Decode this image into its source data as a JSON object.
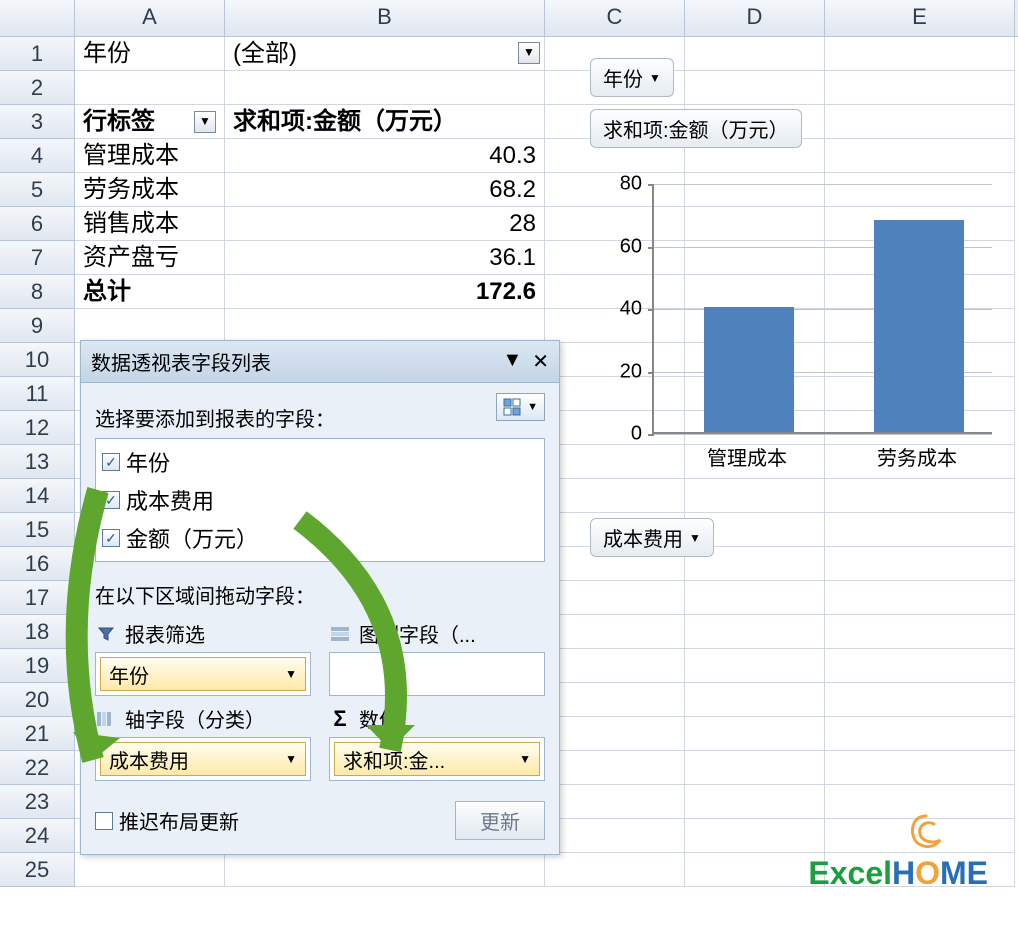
{
  "columns": [
    "A",
    "B",
    "C",
    "D",
    "E"
  ],
  "rows": [
    "1",
    "2",
    "3",
    "4",
    "5",
    "6",
    "7",
    "8",
    "9",
    "10",
    "11",
    "12",
    "13",
    "14",
    "15",
    "16",
    "17",
    "18",
    "19",
    "20",
    "21",
    "22",
    "23",
    "24",
    "25"
  ],
  "pivot": {
    "filter_field": "年份",
    "filter_value": "(全部)",
    "row_label_header": "行标签",
    "value_header": "求和项:金额（万元）",
    "rows": [
      {
        "label": "管理成本",
        "value": "40.3"
      },
      {
        "label": "劳务成本",
        "value": "68.2"
      },
      {
        "label": "销售成本",
        "value": "28"
      },
      {
        "label": "资产盘亏",
        "value": "36.1"
      }
    ],
    "total_label": "总计",
    "total_value": "172.6"
  },
  "panel": {
    "title": "数据透视表字段列表",
    "select_label": "选择要添加到报表的字段：",
    "fields": [
      {
        "name": "年份",
        "checked": true
      },
      {
        "name": "成本费用",
        "checked": true
      },
      {
        "name": "金额（万元）",
        "checked": true
      }
    ],
    "drag_label": "在以下区域间拖动字段：",
    "zones": {
      "filter": {
        "label": "报表筛选",
        "item": "年份"
      },
      "legend": {
        "label": "图例字段（..."
      },
      "axis": {
        "label": "轴字段（分类）",
        "item": "成本费用"
      },
      "values": {
        "label": "数值",
        "item": "求和项:金..."
      }
    },
    "defer_label": "推迟布局更新",
    "update_label": "更新"
  },
  "chart_chips": {
    "year": "年份",
    "value": "求和项:金额（万元）",
    "category": "成本费用"
  },
  "chart_data": {
    "type": "bar",
    "categories": [
      "管理成本",
      "劳务成本"
    ],
    "values": [
      40,
      68
    ],
    "ylim": [
      0,
      80
    ],
    "yticks": [
      0,
      20,
      40,
      60,
      80
    ],
    "title": "",
    "xlabel": "",
    "ylabel": ""
  },
  "logo": {
    "text_excel": "Excel",
    "text_h": "H",
    "text_o": "O",
    "text_me": "ME"
  }
}
